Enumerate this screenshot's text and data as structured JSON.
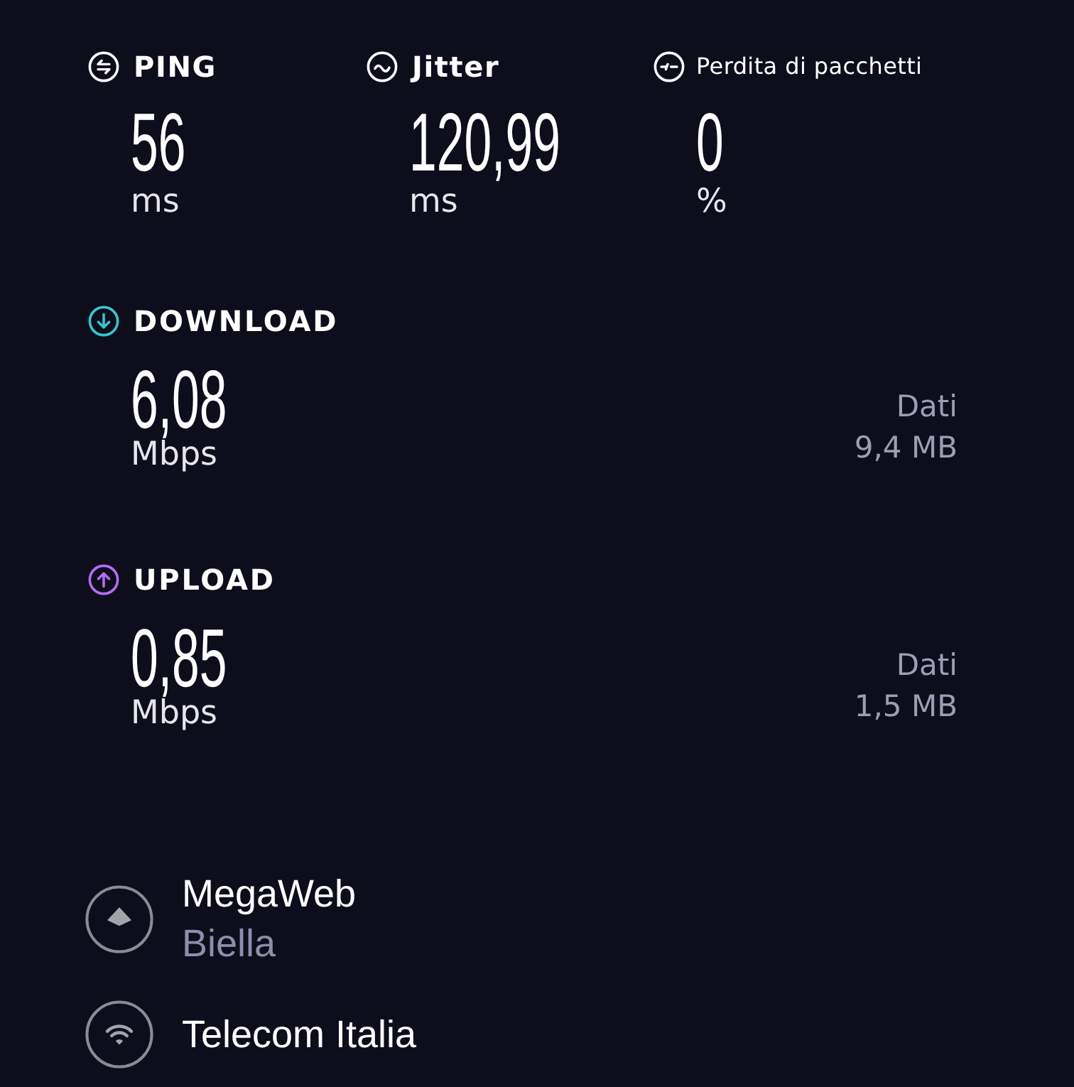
{
  "metrics": [
    {
      "kind": "ping",
      "label": "PING",
      "value": "56",
      "unit": "ms"
    },
    {
      "kind": "jitter",
      "label": "Jitter",
      "value": "120,99",
      "unit": "ms"
    },
    {
      "kind": "packet_loss",
      "label": "Perdita di pacchetti",
      "value": "0",
      "unit": "%"
    }
  ],
  "speeds": [
    {
      "kind": "download",
      "label": "DOWNLOAD",
      "color": "#36c5cb",
      "value": "6,08",
      "unit": "Mbps",
      "data_label": "Dati",
      "data_amount": "9,4 MB"
    },
    {
      "kind": "upload",
      "label": "UPLOAD",
      "color": "#b56cf2",
      "value": "0,85",
      "unit": "Mbps",
      "data_label": "Dati",
      "data_amount": "1,5 MB"
    }
  ],
  "server": {
    "name": "MegaWeb",
    "location": "Biella"
  },
  "provider": {
    "name": "Telecom Italia"
  }
}
